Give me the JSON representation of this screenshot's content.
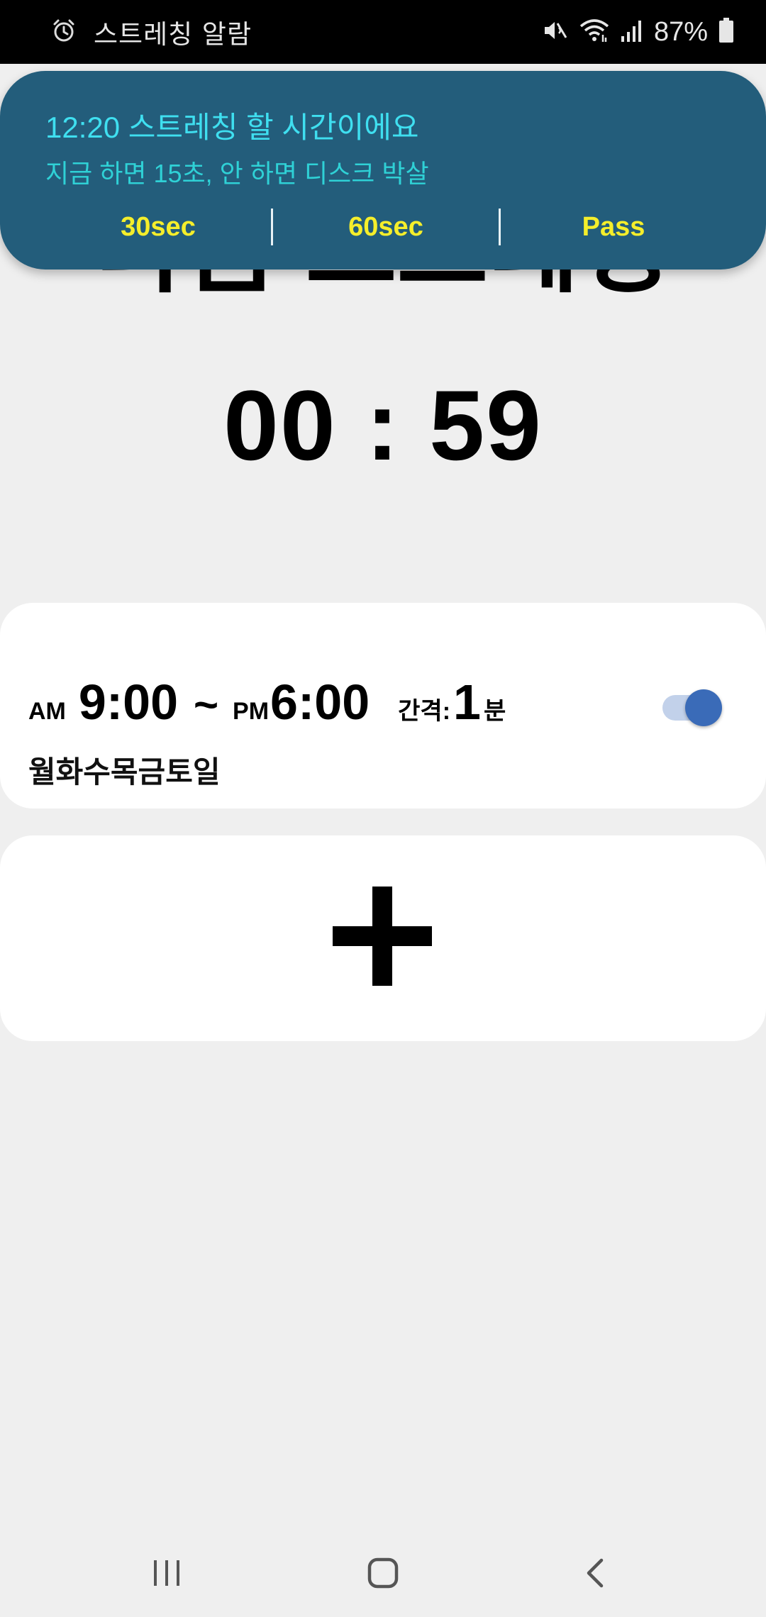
{
  "status_bar": {
    "app_title": "스트레칭 알람",
    "battery": "87%",
    "icons": [
      "alarm-icon",
      "mute-icon",
      "wifi-icon",
      "signal-icon",
      "battery-icon"
    ]
  },
  "notification": {
    "title": "12:20 스트레칭 할 시간이에요",
    "subtitle": "지금 하면 15초, 안 하면 디스크 박살",
    "actions": [
      "30sec",
      "60sec",
      "Pass"
    ],
    "colors": {
      "background": "#235d7b",
      "title": "#3fdff0",
      "actions": "#f5ee2b"
    }
  },
  "main": {
    "heading": "다음 스트레칭",
    "countdown": "00 : 59"
  },
  "alarm": {
    "start_ampm": "AM",
    "start_time": "9:00",
    "separator": "~",
    "end_ampm": "PM",
    "end_time": "6:00",
    "interval_label": "간격:",
    "interval_value": "1",
    "interval_unit": "분",
    "days": "월화수목금토일",
    "enabled": true,
    "toggle_color": "#3a6bb8"
  },
  "add_button": {
    "icon": "plus-icon"
  },
  "nav_bar": {
    "buttons": [
      "recent-apps-icon",
      "home-icon",
      "back-icon"
    ]
  }
}
